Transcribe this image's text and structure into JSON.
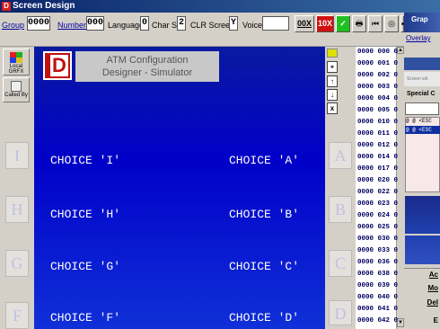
{
  "window": {
    "title": "Screen Design",
    "app_icon_letter": "D"
  },
  "toolbar": {
    "group_label": "Group",
    "group_value": "0000",
    "number_label": "Number",
    "number_value": "000",
    "language_label": "Language",
    "language_value": "0",
    "charset_label": "Char Set",
    "charset_value": "2",
    "clr_label": "CLR Screen",
    "clr_value": "Y",
    "voice_label": "Voice",
    "voice_value": "",
    "btn_0dx": "00X",
    "btn_10x": "10X",
    "btn_check": "✓",
    "btn_print": "🖶",
    "btn_first": "⏮",
    "btn_target": "◎",
    "btn_last": "⏭"
  },
  "left": {
    "local_grfx": "Local GRFX",
    "called_by": "Called By"
  },
  "screen": {
    "logo_letter": "D",
    "header_line1": "ATM Configuration",
    "header_line2": "Designer - Simulator",
    "fdk_left": [
      "I",
      "H",
      "G",
      "F"
    ],
    "fdk_right": [
      "A",
      "B",
      "C",
      "D"
    ],
    "choices_left": [
      "CHOICE 'I'",
      "CHOICE 'H'",
      "CHOICE 'G'",
      "CHOICE 'F'"
    ],
    "choices_right": [
      "CHOICE 'A'",
      "CHOICE 'B'",
      "CHOICE 'C'",
      "CHOICE 'D'"
    ]
  },
  "vtools": [
    "⚬",
    "↑",
    "↓",
    "x"
  ],
  "screen_list": [
    "0000 000 0",
    "0000 001 0",
    "0000 002 0",
    "0000 003 0",
    "0000 004 0",
    "0000 005 0",
    "0000 010 0",
    "0000 011 0",
    "0000 012 0",
    "0000 014 0",
    "0000 017 0",
    "0000 020 0",
    "0000 022 0",
    "0000 023 0",
    "0000 024 0",
    "0000 025 0",
    "0000 030 0",
    "0000 033 0",
    "0000 036 0",
    "0000 038 0",
    "0000 039 0",
    "0000 040 0",
    "0000 041 0",
    "0000 042 0"
  ],
  "right_panel": {
    "header": "Grap",
    "overlay": "Overlay",
    "screen_with": "Screen wit",
    "special": "Special C",
    "esc1": "@ @ <ESC",
    "esc2": "@ @ <ESC",
    "btn_a": "Ac",
    "btn_mo": "Mo",
    "btn_de": "Del",
    "btn_e": "E"
  }
}
